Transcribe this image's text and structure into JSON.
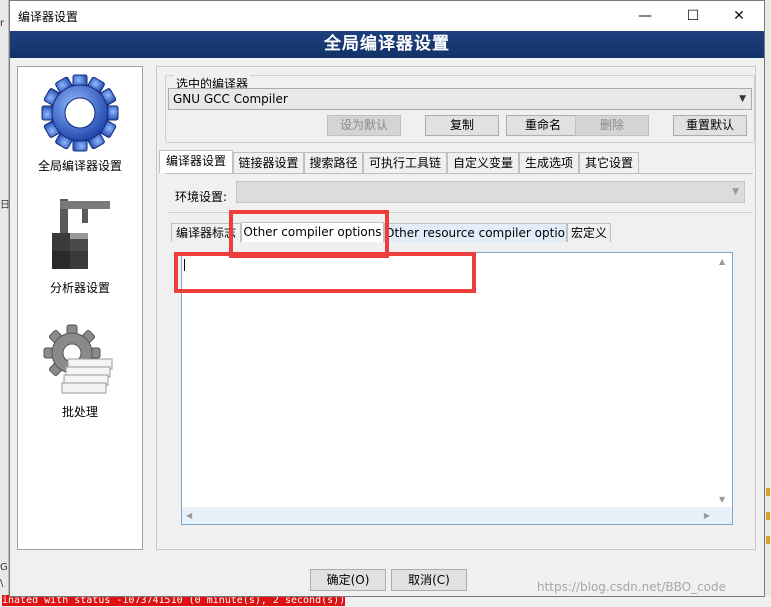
{
  "window": {
    "title": "编译器设置",
    "banner": "全局编译器设置",
    "minimize_glyph": "—",
    "maximize_glyph": "☐",
    "close_glyph": "✕"
  },
  "nav": {
    "items": [
      {
        "label": "全局编译器设置",
        "icon": "gear-icon"
      },
      {
        "label": "分析器设置",
        "icon": "caliper-icon"
      },
      {
        "label": "批处理",
        "icon": "batch-gear-icon"
      }
    ]
  },
  "compiler_group": {
    "legend": "选中的编译器",
    "selected": "GNU GCC Compiler",
    "buttons": {
      "set_default": "设为默认",
      "copy": "复制",
      "rename": "重命名",
      "delete": "删除",
      "reset_defaults": "重置默认"
    }
  },
  "tabs": [
    "编译器设置",
    "链接器设置",
    "搜索路径",
    "可执行工具链",
    "自定义变量",
    "生成选项",
    "其它设置"
  ],
  "env_label": "环境设置:",
  "subtabs": [
    "编译器标志",
    "Other compiler options",
    "Other resource compiler options",
    "宏定义"
  ],
  "editor": {
    "value": ""
  },
  "dialog_buttons": {
    "ok": "确定(O)",
    "cancel": "取消(C)"
  },
  "watermark": "https://blog.csdn.net/BBO_code",
  "background": {
    "log_text": "inated with status -1073741510 (0 minute(s), 2 second(s))",
    "left_fragments": [
      "r",
      "日",
      "G",
      "\\"
    ]
  },
  "colors": {
    "banner": "#1e3f7e",
    "highlight_box": "#ee3d3d",
    "active_tab": "#ffffff"
  }
}
